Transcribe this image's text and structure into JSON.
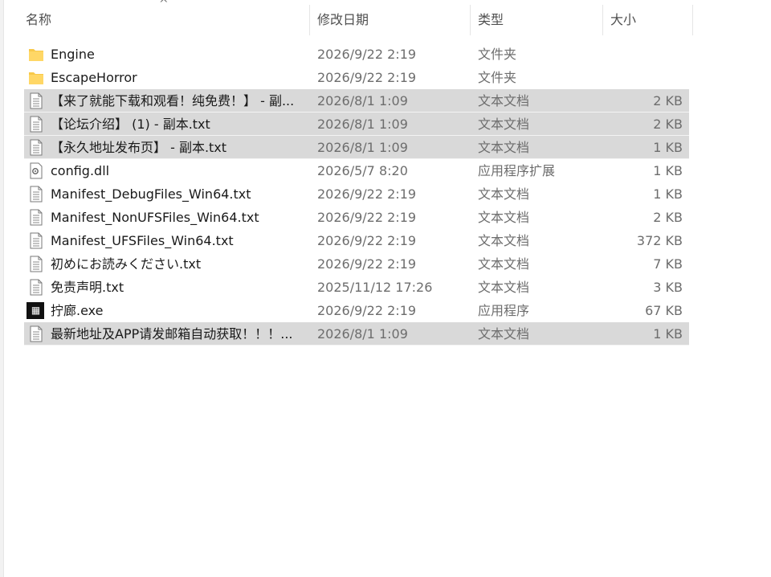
{
  "header": {
    "name": "名称",
    "date": "修改日期",
    "type": "类型",
    "size": "大小",
    "sort_indicator": "^"
  },
  "colors": {
    "selected_row": "#d9d9d9",
    "folder": "#f8c94a",
    "exe_icon": "#111111"
  },
  "files": [
    {
      "name": "Engine",
      "date": "2026/9/22 2:19",
      "type": "文件夹",
      "size": "",
      "icon": "folder-icon",
      "selected": false
    },
    {
      "name": "EscapeHorror",
      "date": "2026/9/22 2:19",
      "type": "文件夹",
      "size": "",
      "icon": "folder-icon",
      "selected": false
    },
    {
      "name": "【来了就能下载和观看！纯免费！】 - 副...",
      "date": "2026/8/1 1:09",
      "type": "文本文档",
      "size": "2 KB",
      "icon": "text-file-icon",
      "selected": true
    },
    {
      "name": "【论坛介绍】 (1) - 副本.txt",
      "date": "2026/8/1 1:09",
      "type": "文本文档",
      "size": "2 KB",
      "icon": "text-file-icon",
      "selected": true
    },
    {
      "name": "【永久地址发布页】 - 副本.txt",
      "date": "2026/8/1 1:09",
      "type": "文本文档",
      "size": "1 KB",
      "icon": "text-file-icon",
      "selected": true
    },
    {
      "name": "config.dll",
      "date": "2026/5/7 8:20",
      "type": "应用程序扩展",
      "size": "1 KB",
      "icon": "dll-file-icon",
      "selected": false
    },
    {
      "name": "Manifest_DebugFiles_Win64.txt",
      "date": "2026/9/22 2:19",
      "type": "文本文档",
      "size": "1 KB",
      "icon": "text-file-icon",
      "selected": false
    },
    {
      "name": "Manifest_NonUFSFiles_Win64.txt",
      "date": "2026/9/22 2:19",
      "type": "文本文档",
      "size": "2 KB",
      "icon": "text-file-icon",
      "selected": false
    },
    {
      "name": "Manifest_UFSFiles_Win64.txt",
      "date": "2026/9/22 2:19",
      "type": "文本文档",
      "size": "372 KB",
      "icon": "text-file-icon",
      "selected": false
    },
    {
      "name": "初めにお読みください.txt",
      "date": "2026/9/22 2:19",
      "type": "文本文档",
      "size": "7 KB",
      "icon": "text-file-icon",
      "selected": false
    },
    {
      "name": "免责声明.txt",
      "date": "2025/11/12 17:26",
      "type": "文本文档",
      "size": "3 KB",
      "icon": "text-file-icon",
      "selected": false
    },
    {
      "name": "拧廊.exe",
      "date": "2026/9/22 2:19",
      "type": "应用程序",
      "size": "67 KB",
      "icon": "exe-app-icon",
      "selected": false
    },
    {
      "name": "最新地址及APP请发邮箱自动获取！！！...",
      "date": "2026/8/1 1:09",
      "type": "文本文档",
      "size": "1 KB",
      "icon": "text-file-icon",
      "selected": true
    }
  ]
}
